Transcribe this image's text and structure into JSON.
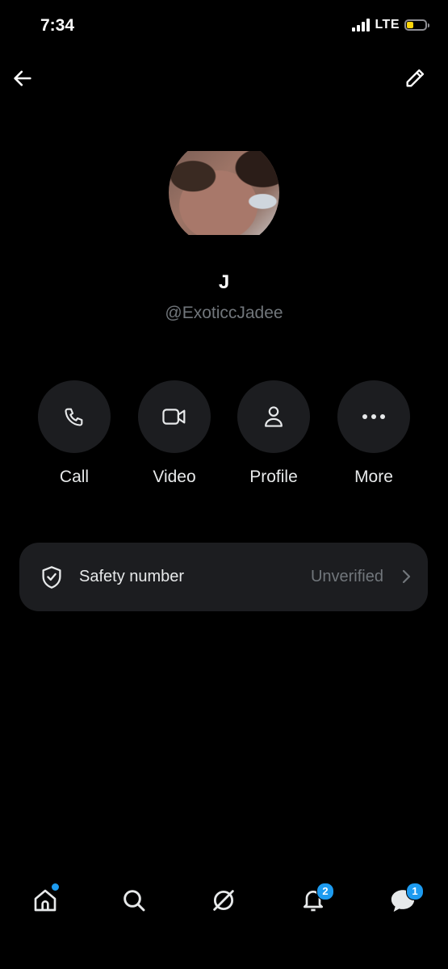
{
  "status_bar": {
    "time": "7:34",
    "network": "LTE",
    "battery_level": 0.35,
    "battery_color": "#ffd60a"
  },
  "header": {
    "back_icon": "arrow-left-icon",
    "edit_icon": "pencil-icon"
  },
  "profile": {
    "avatar": "profile-photo",
    "display_name": "J",
    "handle": "@ExoticcJadee"
  },
  "actions": [
    {
      "label": "Call",
      "icon": "phone-icon"
    },
    {
      "label": "Video",
      "icon": "video-camera-icon"
    },
    {
      "label": "Profile",
      "icon": "person-icon"
    },
    {
      "label": "More",
      "icon": "more-dots-icon"
    }
  ],
  "safety": {
    "label": "Safety number",
    "status": "Unverified",
    "icon": "shield-check-icon"
  },
  "tab_bar": {
    "items": [
      {
        "name": "home",
        "icon": "home-icon",
        "indicator": "dot"
      },
      {
        "name": "search",
        "icon": "search-icon"
      },
      {
        "name": "grok",
        "icon": "grok-icon"
      },
      {
        "name": "notifications",
        "icon": "bell-icon",
        "badge": "2"
      },
      {
        "name": "messages",
        "icon": "message-icon",
        "badge": "1"
      }
    ],
    "accent_color": "#1d9bf0"
  }
}
